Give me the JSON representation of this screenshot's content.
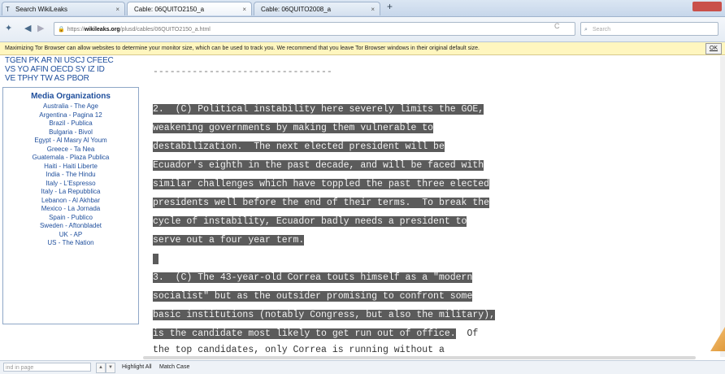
{
  "tabs": [
    {
      "label": "Search WikiLeaks",
      "close": "×"
    },
    {
      "label": "Cable: 06QUITO2150_a",
      "close": "×"
    },
    {
      "label": "Cable: 06QUITO2008_a",
      "close": "×"
    }
  ],
  "new_tab_label": "+",
  "url": {
    "scheme": "https://",
    "host": "wikileaks.org",
    "path": "/plusd/cables/06QUITO2150_a.html"
  },
  "search_placeholder": "Search",
  "notification": {
    "text": "Maximizing Tor Browser can allow websites to determine your monitor size, which can be used to track you. We recommend that you leave Tor Browser windows in their original default size.",
    "ok_label": "OK"
  },
  "sidebar": {
    "tags_lines": [
      "TGEN PK AR NI USCJ CFEEC",
      "VS YO AFIN OECD SY IZ ID",
      "VE TPHY TW AS PBOR"
    ],
    "media_title": "Media Organizations",
    "media": [
      "Australia - The Age",
      "Argentina - Pagina 12",
      "Brazil - Publica",
      "Bulgaria - Bivol",
      "Egypt - Al Masry Al Youm",
      "Greece - Ta Nea",
      "Guatemala - Plaza Publica",
      "Haiti - Haiti Liberte",
      "India - The Hindu",
      "Italy - L'Espresso",
      "Italy - La Repubblica",
      "Lebanon - Al Akhbar",
      "Mexico - La Jornada",
      "Spain - Publico",
      "Sweden - Aftonbladet",
      "UK - AP",
      "US - The Nation"
    ]
  },
  "document": {
    "separator": "--------------------------------",
    "lines": [
      "2.  (C) Political instability here severely limits the GOE,",
      "weakening governments by making them vulnerable to",
      "destabilization.  The next elected president will be",
      "Ecuador's eighth in the past decade, and will be faced with",
      "similar challenges which have toppled the past three elected",
      "presidents well before the end of their terms.  To break the",
      "cycle of instability, Ecuador badly needs a president to",
      "serve out a four year term.",
      " ",
      "3.  (C) The 43-year-old Correa touts himself as a \"modern",
      "socialist\" but as the outsider promising to confront some",
      "basic institutions (notably Congress, but also the military),",
      "is the candidate most likely to get run out of office.",
      "the top candidates, only Correa is running without a"
    ],
    "line13_tail": "  Of"
  },
  "findbar": {
    "placeholder": "ind in page",
    "prev": "▲",
    "next": "▼",
    "highlight_all": "Highlight All",
    "match_case": "Match Case"
  }
}
